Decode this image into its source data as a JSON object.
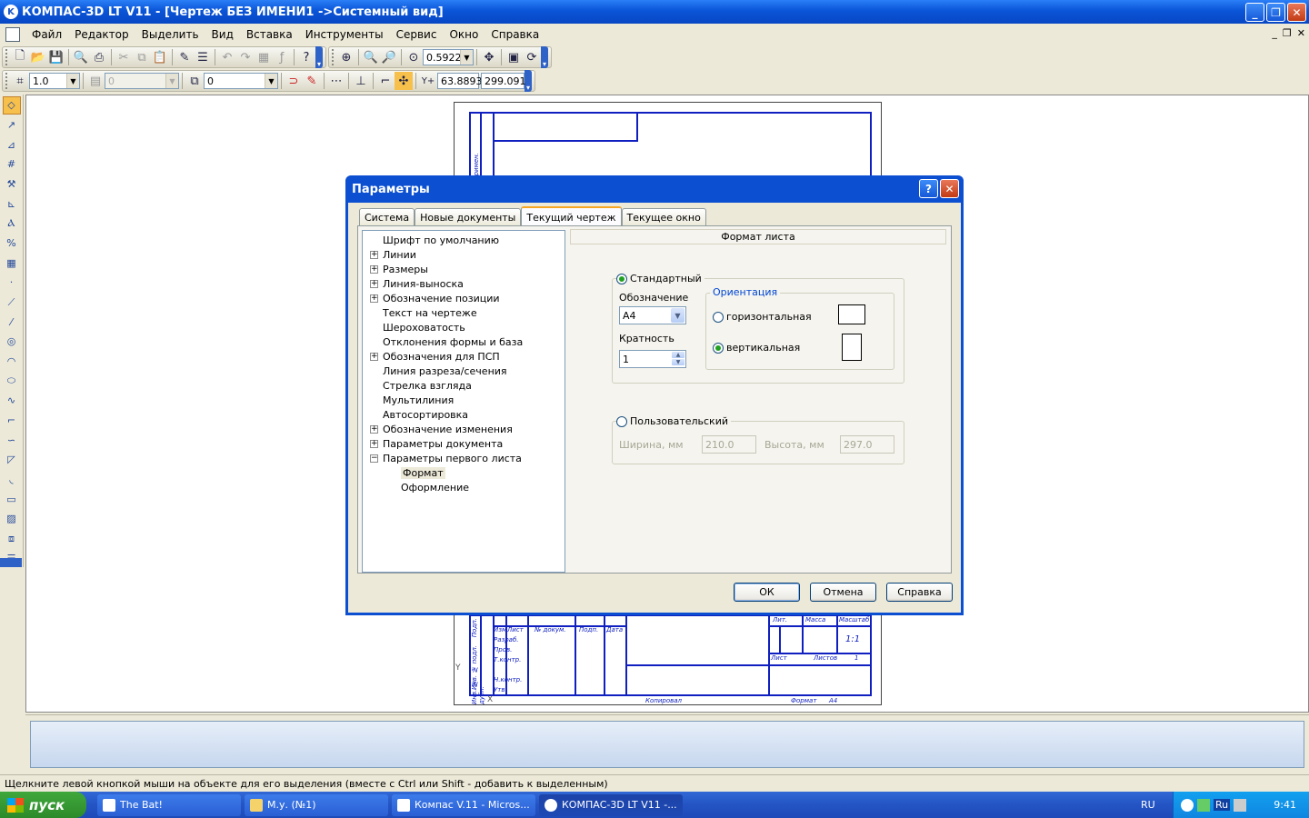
{
  "window": {
    "title": "КОМПАС-3D LT V11 - [Чертеж БЕЗ ИМЕНИ1 ->Системный вид]",
    "icon_letter": "K",
    "minimize": "_",
    "restore": "❐",
    "close": "✕"
  },
  "menu": {
    "items": [
      "Файл",
      "Редактор",
      "Выделить",
      "Вид",
      "Вставка",
      "Инструменты",
      "Сервис",
      "Окно",
      "Справка"
    ],
    "mdi_min": "_",
    "mdi_restore": "❐",
    "mdi_close": "✕"
  },
  "toolbar1": {
    "zoom_value": "0.5922"
  },
  "toolbar2": {
    "line_scale": "1.0",
    "layer_disabled": "0",
    "style_value": "0",
    "coord_x_label": "Y+",
    "coord_x": "63.8893",
    "coord_y": "299.091"
  },
  "drawing": {
    "cells": [
      "Изм",
      "Лист",
      "№ докум.",
      "Подп.",
      "Дата",
      "Разраб.",
      "Пров.",
      "Т.контр.",
      "Н.контр.",
      "Утв.",
      "Лит.",
      "Масса",
      "Масштаб",
      "1:1",
      "Лист",
      "Листов",
      "1",
      "Копировал",
      "Формат",
      "А4",
      "Подп.",
      "Инв. № подл.",
      "Инв. № дубл."
    ],
    "axis_y": "Y",
    "axis_x": "X"
  },
  "status": {
    "hint": "Щелкните левой кнопкой мыши на объекте для его выделения (вместе с Ctrl или Shift - добавить к выделенным)"
  },
  "taskbar": {
    "start": "пуск",
    "tasks": [
      {
        "label": "The Bat!"
      },
      {
        "label": "М.у. (№1)"
      },
      {
        "label": "Компас V.11 - Micros..."
      },
      {
        "label": "КОМПАС-3D LT V11 -..."
      }
    ],
    "lang": "RU",
    "tray_lang2": "Ru",
    "clock": "9:41"
  },
  "dialog": {
    "title": "Параметры",
    "help_btn": "?",
    "close_btn": "✕",
    "tabs": [
      "Система",
      "Новые документы",
      "Текущий чертеж",
      "Текущее окно"
    ],
    "active_tab": 2,
    "tree": [
      {
        "label": "Шрифт по умолчанию",
        "expander": ""
      },
      {
        "label": "Линии",
        "expander": "+"
      },
      {
        "label": "Размеры",
        "expander": "+"
      },
      {
        "label": "Линия-выноска",
        "expander": "+"
      },
      {
        "label": "Обозначение позиции",
        "expander": "+"
      },
      {
        "label": "Текст на чертеже",
        "expander": ""
      },
      {
        "label": "Шероховатость",
        "expander": ""
      },
      {
        "label": "Отклонения формы и база",
        "expander": ""
      },
      {
        "label": "Обозначения для ПСП",
        "expander": "+"
      },
      {
        "label": "Линия разреза/сечения",
        "expander": ""
      },
      {
        "label": "Стрелка взгляда",
        "expander": ""
      },
      {
        "label": "Мультилиния",
        "expander": ""
      },
      {
        "label": "Автосортировка",
        "expander": ""
      },
      {
        "label": "Обозначение изменения",
        "expander": "+"
      },
      {
        "label": "Параметры документа",
        "expander": "+"
      },
      {
        "label": "Параметры первого листа",
        "expander": "−"
      },
      {
        "label": "Формат",
        "expander": "",
        "child": true,
        "selected": true
      },
      {
        "label": "Оформление",
        "expander": "",
        "child": true
      }
    ],
    "panel_header": "Формат листа",
    "standard": {
      "label": "Стандартный",
      "checked": true,
      "designation_label": "Обозначение",
      "designation_value": "А4",
      "multiplicity_label": "Кратность",
      "multiplicity_value": "1",
      "orientation_label": "Ориентация",
      "horizontal_label": "горизонтальная",
      "vertical_label": "вертикальная",
      "orientation_selected": "vertical"
    },
    "custom": {
      "label": "Пользовательский",
      "checked": false,
      "width_label": "Ширина, мм",
      "width_value": "210.0",
      "height_label": "Высота, мм",
      "height_value": "297.0"
    },
    "buttons": {
      "ok": "ОК",
      "cancel": "Отмена",
      "help": "Справка"
    }
  }
}
